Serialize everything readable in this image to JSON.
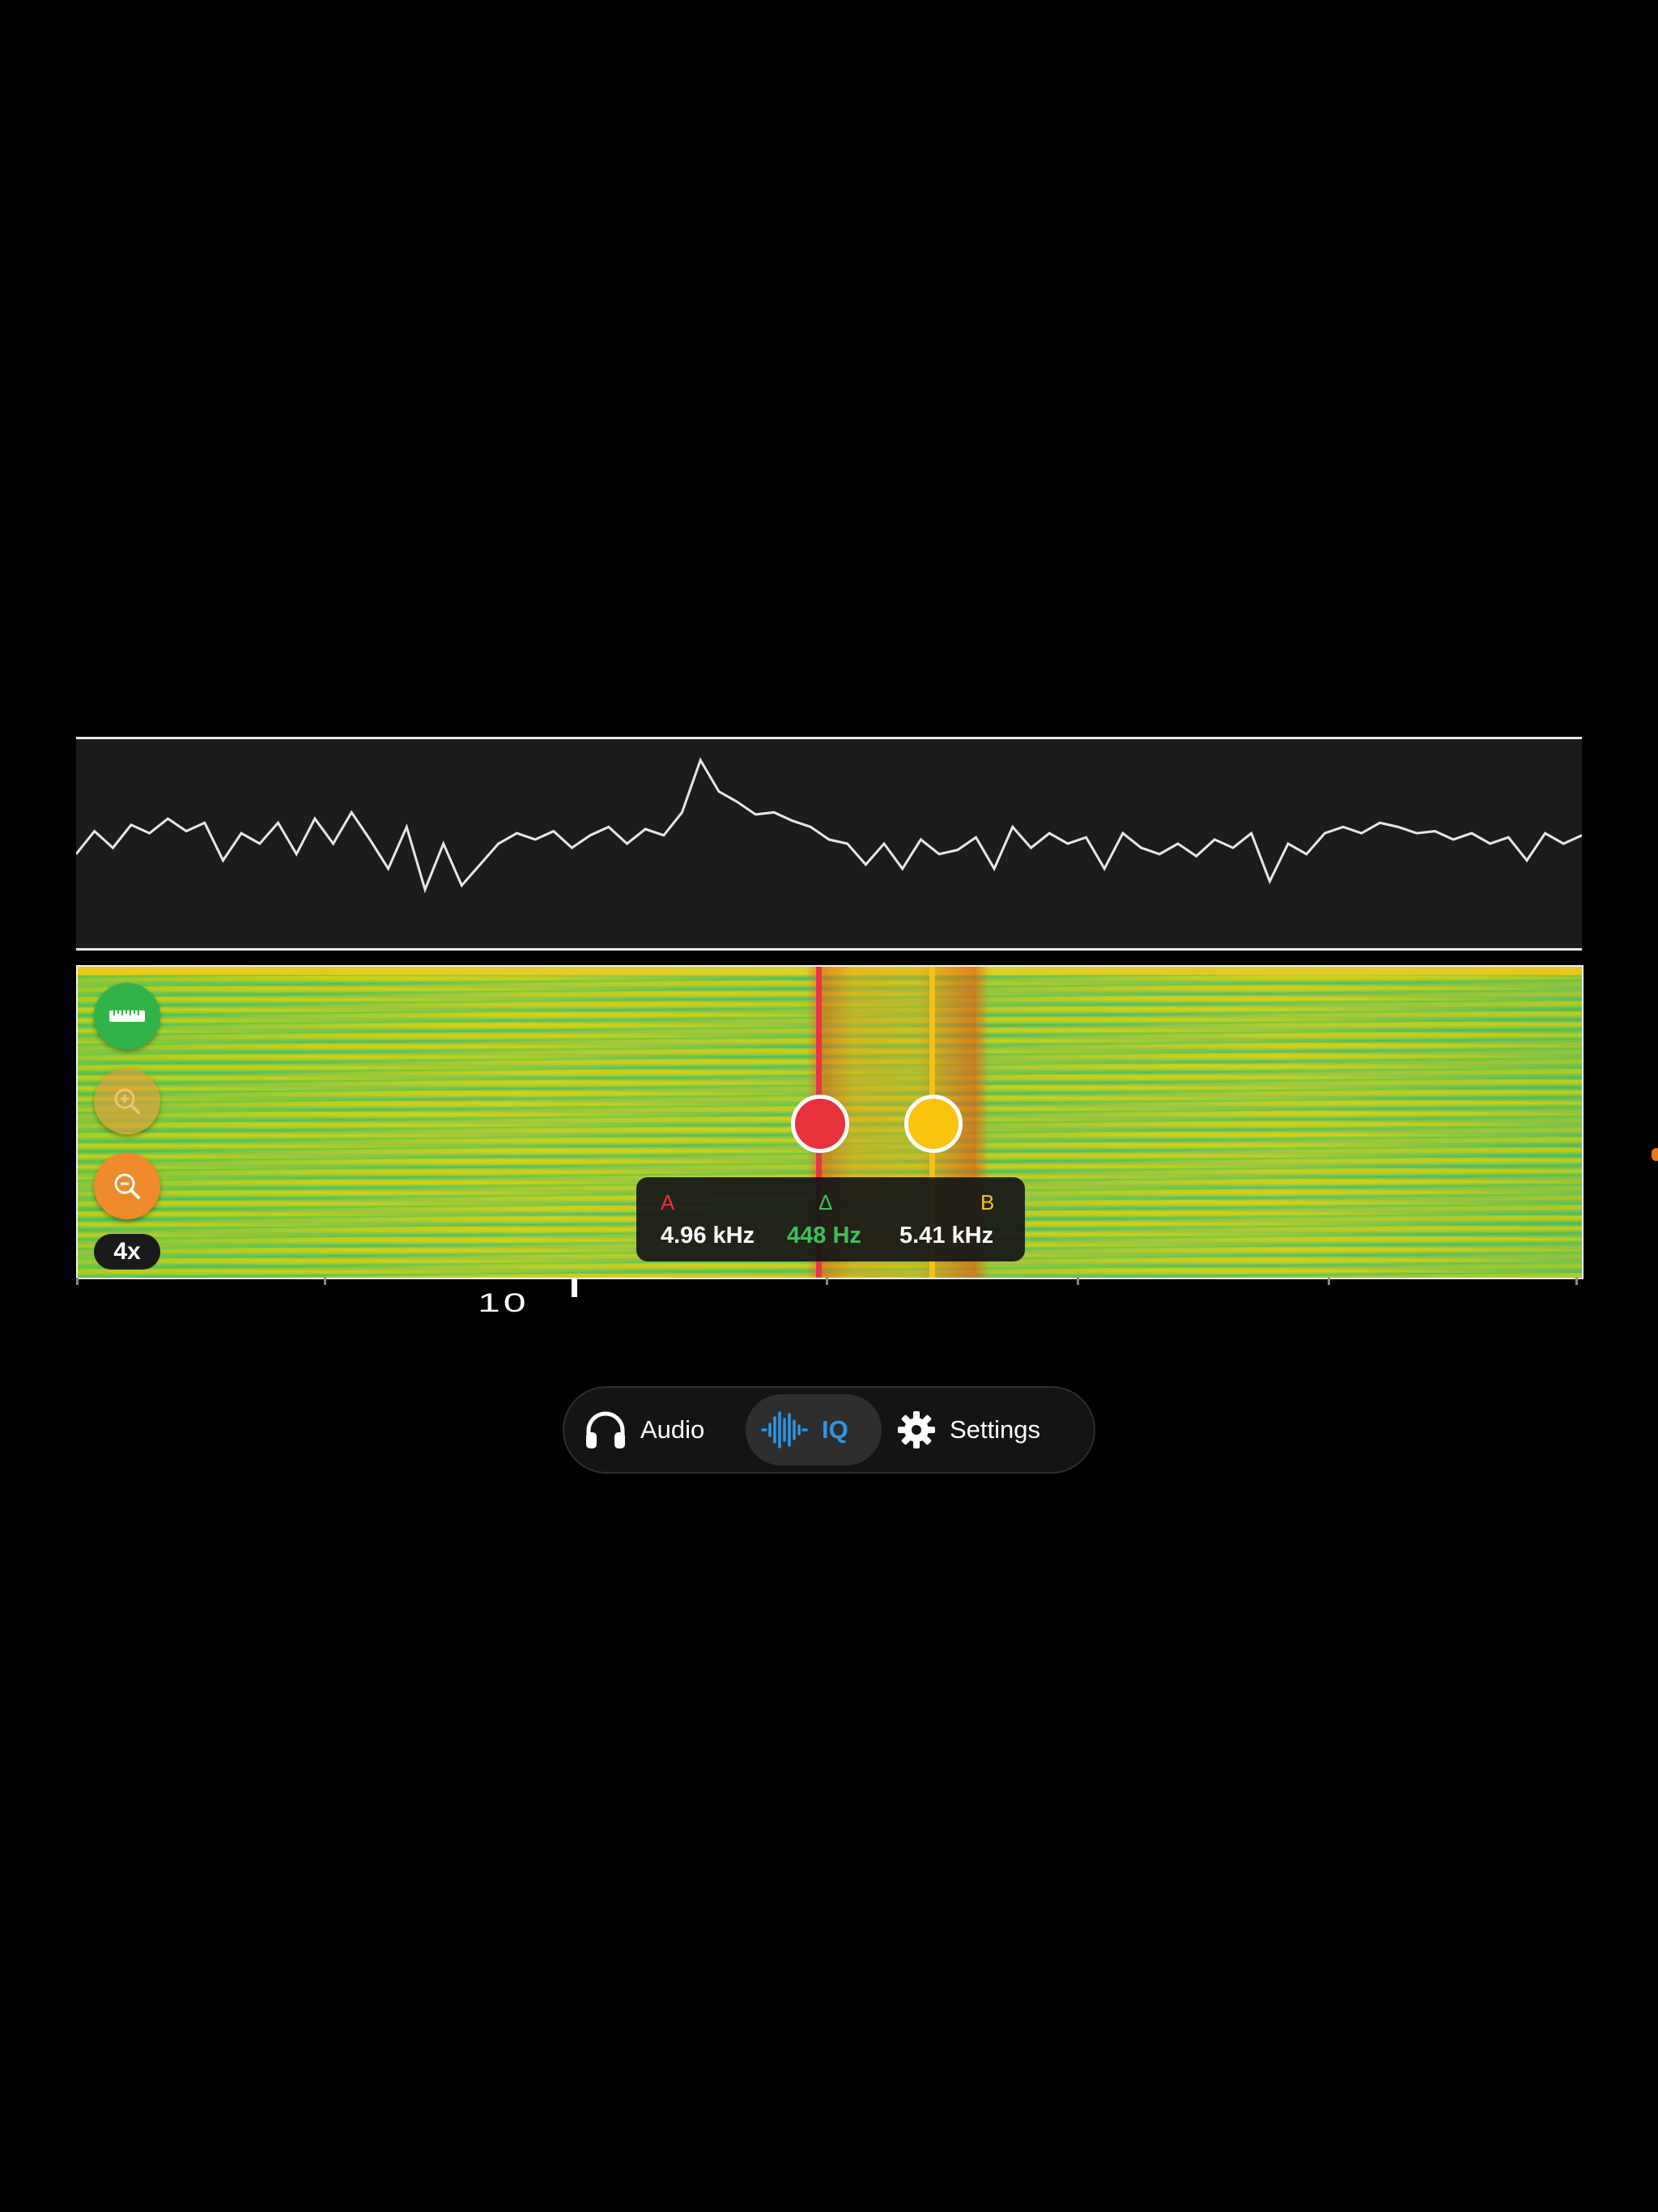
{
  "spectrum": {
    "trace": [
      0.55,
      0.44,
      0.52,
      0.41,
      0.45,
      0.38,
      0.44,
      0.4,
      0.58,
      0.45,
      0.5,
      0.4,
      0.55,
      0.38,
      0.5,
      0.35,
      0.48,
      0.62,
      0.42,
      0.72,
      0.5,
      0.7,
      0.6,
      0.5,
      0.45,
      0.48,
      0.44,
      0.52,
      0.46,
      0.42,
      0.5,
      0.43,
      0.46,
      0.35,
      0.1,
      0.25,
      0.3,
      0.36,
      0.35,
      0.39,
      0.42,
      0.48,
      0.5,
      0.6,
      0.5,
      0.62,
      0.48,
      0.55,
      0.53,
      0.47,
      0.62,
      0.42,
      0.52,
      0.45,
      0.5,
      0.47,
      0.62,
      0.45,
      0.52,
      0.55,
      0.5,
      0.56,
      0.48,
      0.52,
      0.45,
      0.68,
      0.5,
      0.55,
      0.45,
      0.42,
      0.45,
      0.4,
      0.42,
      0.45,
      0.44,
      0.48,
      0.45,
      0.5,
      0.47,
      0.58,
      0.45,
      0.5,
      0.46
    ]
  },
  "waterfall": {
    "cursor_a": {
      "label": "A",
      "value": "4.96 kHz",
      "color": "#e8323e"
    },
    "delta": {
      "label": "Δ",
      "value": "448 Hz",
      "color": "#3cc25a"
    },
    "cursor_b": {
      "label": "B",
      "value": "5.41 kHz",
      "color": "#f9c40e"
    },
    "zoom_level": "4x"
  },
  "axis": {
    "label": "10"
  },
  "tabs": [
    {
      "label": "Audio",
      "icon": "headphones-icon",
      "selected": false
    },
    {
      "label": "IQ",
      "icon": "waveform-icon",
      "selected": true,
      "accent": "#2d95e6"
    },
    {
      "label": "Settings",
      "icon": "gear-icon",
      "selected": false
    }
  ]
}
